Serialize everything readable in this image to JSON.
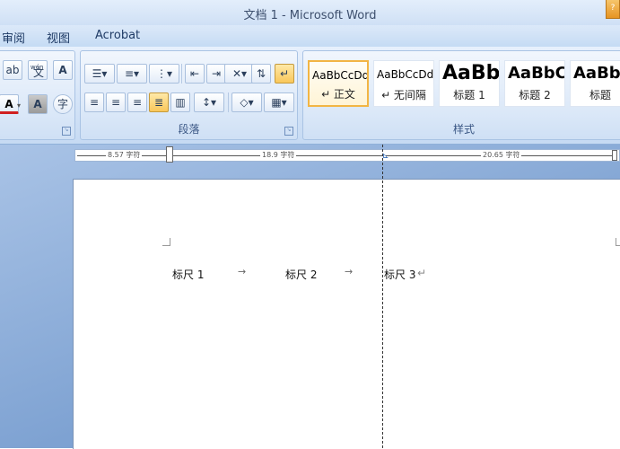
{
  "window": {
    "title": "文档 1 - Microsoft Word"
  },
  "tabs": [
    {
      "label": "审阅"
    },
    {
      "label": "视图"
    },
    {
      "label": "Acrobat"
    }
  ],
  "ribbon": {
    "font_group": {
      "phonetic_label": "wén",
      "phonetic_char": "文"
    },
    "paragraph_group": {
      "label": "段落"
    },
    "styles_group": {
      "label": "样式",
      "items": [
        {
          "sample": "AaBbCcDd",
          "name": "↵ 正文",
          "selected": true
        },
        {
          "sample": "AaBbCcDd",
          "name": "↵ 无间隔",
          "selected": false
        },
        {
          "sample": "AaBb",
          "name": "标题 1",
          "selected": false
        },
        {
          "sample": "AaBbC",
          "name": "标题 2",
          "selected": false
        },
        {
          "sample": "AaBbC",
          "name": "标题",
          "selected": false
        }
      ]
    }
  },
  "ruler": {
    "labels": [
      "8.57 字符",
      "18.9 字符",
      "20.65 字符"
    ]
  },
  "document": {
    "text_1": "标尺 1",
    "text_2": "标尺 2",
    "text_3": "标尺 3",
    "paragraph_mark": "↵",
    "tab_arrow": "→"
  },
  "colors": {
    "accent": "#f2b544",
    "ribbon_text": "#3b5785"
  }
}
